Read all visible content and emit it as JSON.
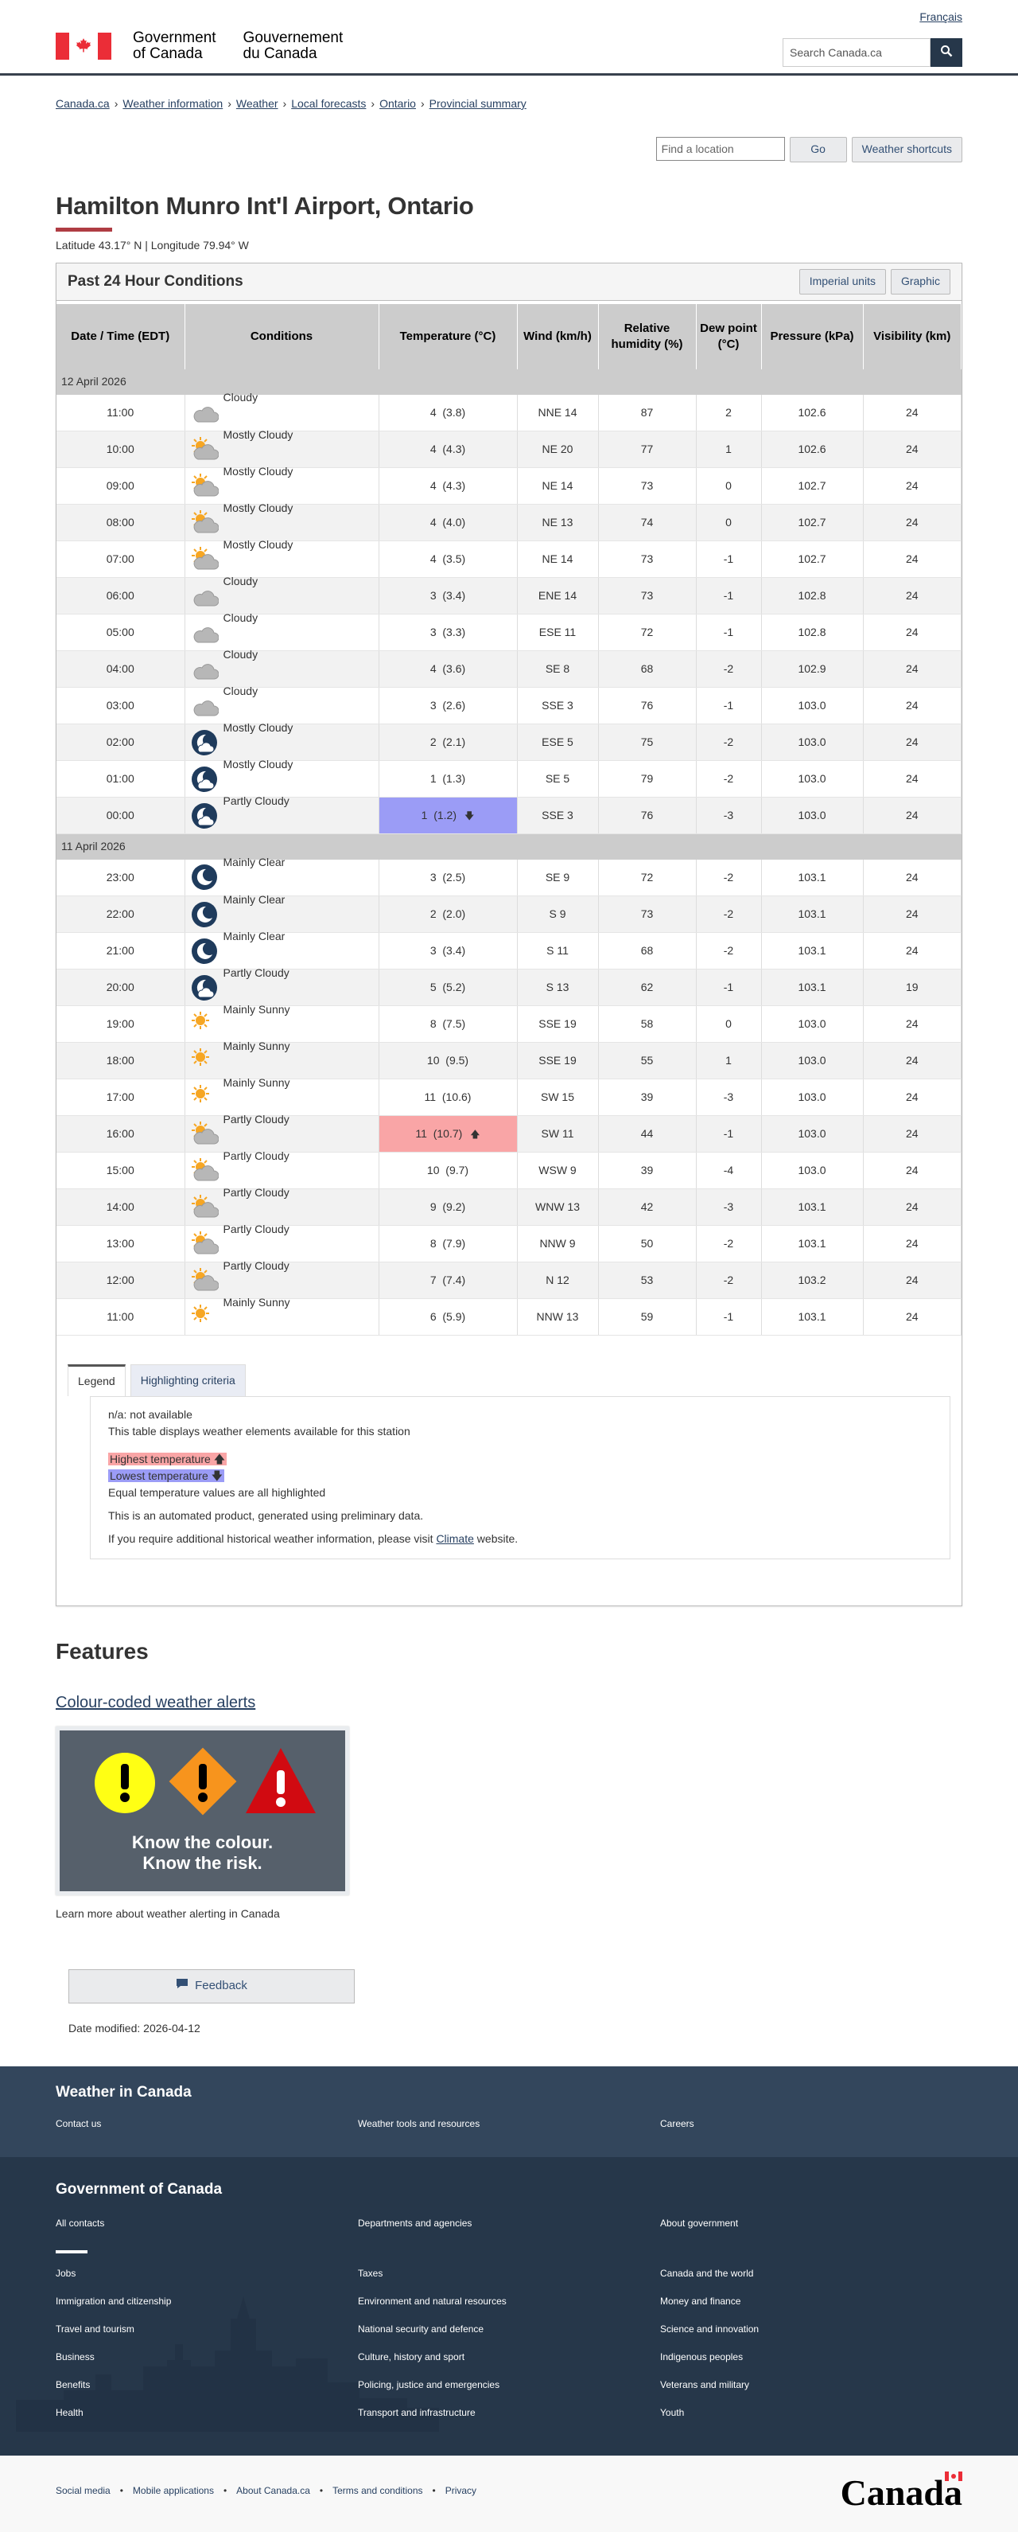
{
  "header": {
    "lang": "Français",
    "gov_en_1": "Government",
    "gov_en_2": "of Canada",
    "gov_fr_1": "Gouvernement",
    "gov_fr_2": "du Canada",
    "search_placeholder": "Search Canada.ca",
    "search_icon": "magnifier-icon"
  },
  "breadcrumbs": [
    "Canada.ca",
    "Weather information",
    "Weather",
    "Local forecasts",
    "Ontario",
    "Provincial summary"
  ],
  "toolbar": {
    "location_placeholder": "Find a location",
    "go": "Go",
    "shortcuts": "Weather shortcuts"
  },
  "page": {
    "title": "Hamilton Munro Int'l Airport, Ontario",
    "latlon": "Latitude 43.17° N | Longitude 79.94° W"
  },
  "panel": {
    "title": "Past 24 Hour Conditions",
    "imperial": "Imperial units",
    "graphic": "Graphic"
  },
  "table": {
    "headers": [
      "Date / Time (EDT)",
      "Conditions",
      "Temperature (°C)",
      "Wind (km/h)",
      "Relative humidity (%)",
      "Dew point (°C)",
      "Pressure (kPa)",
      "Visibility (km)"
    ],
    "groups": [
      {
        "date": "12 April 2026",
        "rows": [
          [
            "11:00",
            "Cloudy",
            "cloud",
            "4",
            "(3.8)",
            "NNE 14",
            "87",
            "2",
            "102.6",
            "24",
            ""
          ],
          [
            "10:00",
            "Mostly Cloudy",
            "suncloud",
            "4",
            "(4.3)",
            "NE 20",
            "77",
            "1",
            "102.6",
            "24",
            ""
          ],
          [
            "09:00",
            "Mostly Cloudy",
            "suncloud",
            "4",
            "(4.3)",
            "NE 14",
            "73",
            "0",
            "102.7",
            "24",
            ""
          ],
          [
            "08:00",
            "Mostly Cloudy",
            "suncloud",
            "4",
            "(4.0)",
            "NE 13",
            "74",
            "0",
            "102.7",
            "24",
            ""
          ],
          [
            "07:00",
            "Mostly Cloudy",
            "suncloud",
            "4",
            "(3.5)",
            "NE 14",
            "73",
            "-1",
            "102.7",
            "24",
            ""
          ],
          [
            "06:00",
            "Cloudy",
            "cloud",
            "3",
            "(3.4)",
            "ENE 14",
            "73",
            "-1",
            "102.8",
            "24",
            ""
          ],
          [
            "05:00",
            "Cloudy",
            "cloud",
            "3",
            "(3.3)",
            "ESE 11",
            "72",
            "-1",
            "102.8",
            "24",
            ""
          ],
          [
            "04:00",
            "Cloudy",
            "cloud",
            "4",
            "(3.6)",
            "SE 8",
            "68",
            "-2",
            "102.9",
            "24",
            ""
          ],
          [
            "03:00",
            "Cloudy",
            "cloud",
            "3",
            "(2.6)",
            "SSE 3",
            "76",
            "-1",
            "103.0",
            "24",
            ""
          ],
          [
            "02:00",
            "Mostly Cloudy",
            "mooncloud",
            "2",
            "(2.1)",
            "ESE 5",
            "75",
            "-2",
            "103.0",
            "24",
            ""
          ],
          [
            "01:00",
            "Mostly Cloudy",
            "mooncloud",
            "1",
            "(1.3)",
            "SE 5",
            "79",
            "-2",
            "103.0",
            "24",
            ""
          ],
          [
            "00:00",
            "Partly Cloudy",
            "mooncloud",
            "1",
            "(1.2)",
            "SSE 3",
            "76",
            "-3",
            "103.0",
            "24",
            "lo"
          ]
        ]
      },
      {
        "date": "11 April 2026",
        "rows": [
          [
            "23:00",
            "Mainly Clear",
            "moon",
            "3",
            "(2.5)",
            "SE 9",
            "72",
            "-2",
            "103.1",
            "24",
            ""
          ],
          [
            "22:00",
            "Mainly Clear",
            "moon",
            "2",
            "(2.0)",
            "S 9",
            "73",
            "-2",
            "103.1",
            "24",
            ""
          ],
          [
            "21:00",
            "Mainly Clear",
            "moon",
            "3",
            "(3.4)",
            "S 11",
            "68",
            "-2",
            "103.1",
            "24",
            ""
          ],
          [
            "20:00",
            "Partly Cloudy",
            "mooncloud",
            "5",
            "(5.2)",
            "S 13",
            "62",
            "-1",
            "103.1",
            "19",
            ""
          ],
          [
            "19:00",
            "Mainly Sunny",
            "sun",
            "8",
            "(7.5)",
            "SSE 19",
            "58",
            "0",
            "103.0",
            "24",
            ""
          ],
          [
            "18:00",
            "Mainly Sunny",
            "sun",
            "10",
            "(9.5)",
            "SSE 19",
            "55",
            "1",
            "103.0",
            "24",
            ""
          ],
          [
            "17:00",
            "Mainly Sunny",
            "sun",
            "11",
            "(10.6)",
            "SW 15",
            "39",
            "-3",
            "103.0",
            "24",
            ""
          ],
          [
            "16:00",
            "Partly Cloudy",
            "suncloud",
            "11",
            "(10.7)",
            "SW 11",
            "44",
            "-1",
            "103.0",
            "24",
            "hi"
          ],
          [
            "15:00",
            "Partly Cloudy",
            "suncloud",
            "10",
            "(9.7)",
            "WSW 9",
            "39",
            "-4",
            "103.0",
            "24",
            ""
          ],
          [
            "14:00",
            "Partly Cloudy",
            "suncloud",
            "9",
            "(9.2)",
            "WNW 13",
            "42",
            "-3",
            "103.1",
            "24",
            ""
          ],
          [
            "13:00",
            "Partly Cloudy",
            "suncloud",
            "8",
            "(7.9)",
            "NNW 9",
            "50",
            "-2",
            "103.1",
            "24",
            ""
          ],
          [
            "12:00",
            "Partly Cloudy",
            "suncloud",
            "7",
            "(7.4)",
            "N 12",
            "53",
            "-2",
            "103.2",
            "24",
            ""
          ],
          [
            "11:00",
            "Mainly Sunny",
            "sun",
            "6",
            "(5.9)",
            "NNW 13",
            "59",
            "-1",
            "103.1",
            "24",
            ""
          ]
        ]
      }
    ]
  },
  "legend": {
    "tab1": "Legend",
    "tab2": "Highlighting criteria",
    "na": "n/a: not available",
    "desc": "This table displays weather elements available for this station",
    "hi": "Highest temperature",
    "lo": "Lowest temperature",
    "equal": "Equal temperature values are all highlighted",
    "auto": "This is an automated product, generated using preliminary data.",
    "hist_pre": "If you require additional historical weather information, please visit ",
    "hist_link": "Climate",
    "hist_post": " website."
  },
  "features": {
    "title": "Features",
    "link": "Colour-coded weather alerts",
    "img_line1": "Know the colour.",
    "img_line2": "Know the risk.",
    "learn": "Learn more about weather alerting in Canada"
  },
  "feedback": "Feedback",
  "modified": "Date modified: 2026-04-12",
  "footer1": {
    "title": "Weather in Canada",
    "links": [
      "Contact us",
      "Weather tools and resources",
      "Careers"
    ]
  },
  "footer2": {
    "title": "Government of Canada",
    "links": [
      "All contacts",
      "Departments and agencies",
      "About government",
      "Jobs",
      "Taxes",
      "Canada and the world",
      "Immigration and citizenship",
      "Environment and natural resources",
      "Money and finance",
      "Travel and tourism",
      "National security and defence",
      "Science and innovation",
      "Business",
      "Culture, history and sport",
      "Indigenous peoples",
      "Benefits",
      "Policing, justice and emergencies",
      "Veterans and military",
      "Health",
      "Transport and infrastructure",
      "Youth"
    ]
  },
  "footer3": {
    "links": [
      "Social media",
      "Mobile applications",
      "About Canada.ca",
      "Terms and conditions",
      "Privacy"
    ],
    "wordmark": "Canada"
  }
}
